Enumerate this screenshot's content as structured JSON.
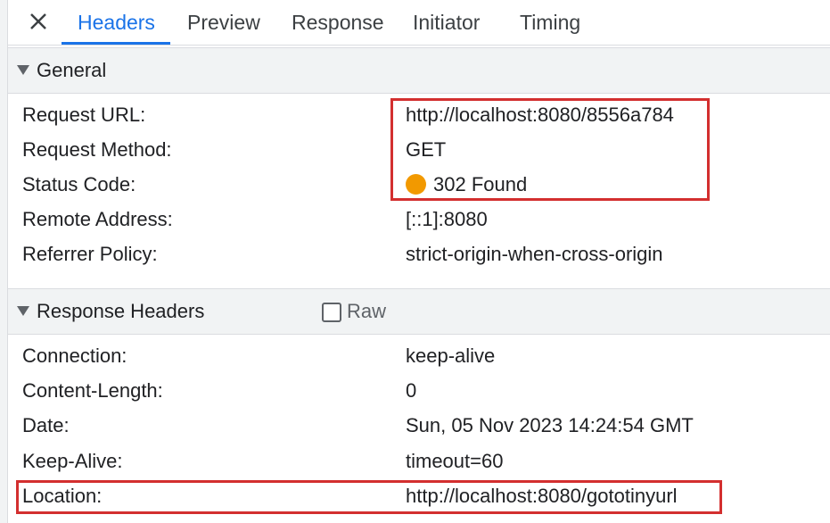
{
  "tabs": [
    {
      "label": "Headers"
    },
    {
      "label": "Preview"
    },
    {
      "label": "Response"
    },
    {
      "label": "Initiator"
    },
    {
      "label": "Timing"
    }
  ],
  "general": {
    "title": "General",
    "rows": [
      {
        "key": "Request URL:",
        "value": "http://localhost:8080/8556a784"
      },
      {
        "key": "Request Method:",
        "value": "GET"
      },
      {
        "key": "Status Code:",
        "value": "302 Found"
      },
      {
        "key": "Remote Address:",
        "value": "[::1]:8080"
      },
      {
        "key": "Referrer Policy:",
        "value": "strict-origin-when-cross-origin"
      }
    ]
  },
  "response_headers": {
    "title": "Response Headers",
    "raw_label": "Raw",
    "raw_checked": false,
    "rows": [
      {
        "key": "Connection:",
        "value": "keep-alive"
      },
      {
        "key": "Content-Length:",
        "value": "0"
      },
      {
        "key": "Date:",
        "value": "Sun, 05 Nov 2023 14:24:54 GMT"
      },
      {
        "key": "Keep-Alive:",
        "value": "timeout=60"
      },
      {
        "key": "Location:",
        "value": "http://localhost:8080/gototinyurl"
      }
    ]
  },
  "colors": {
    "accent": "#1a73e8",
    "status_dot": "#f29900",
    "highlight": "#d32f2f"
  }
}
